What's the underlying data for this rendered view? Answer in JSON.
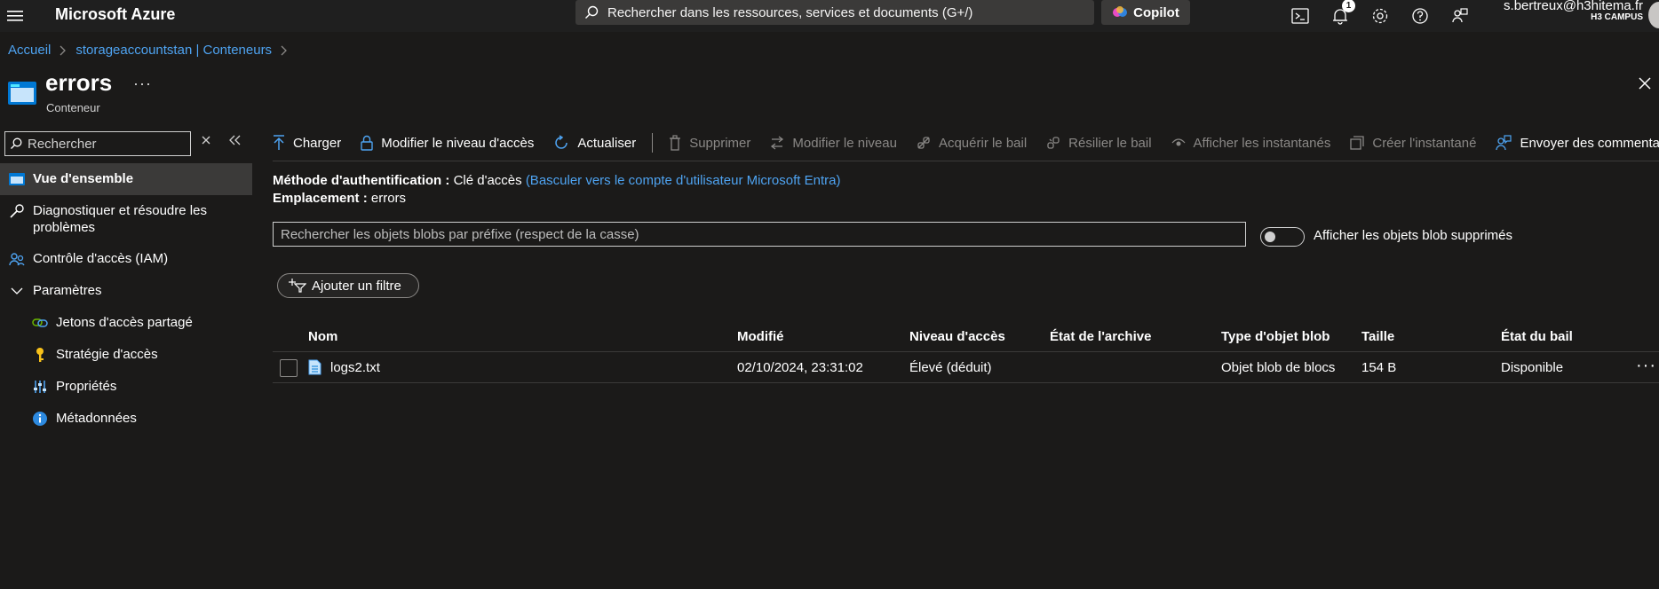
{
  "topbar": {
    "brand": "Microsoft Azure",
    "search_placeholder": "Rechercher dans les ressources, services et documents (G+/)",
    "copilot_label": "Copilot",
    "notification_count": "1",
    "user_email": "s.bertreux@h3hitema.fr",
    "user_tenant": "H3 CAMPUS"
  },
  "breadcrumb": {
    "items": [
      "Accueil",
      "storageaccountstan | Conteneurs"
    ]
  },
  "header": {
    "title": "errors",
    "subtitle": "Conteneur",
    "more": "···"
  },
  "sidebar": {
    "search_placeholder": "Rechercher",
    "items": [
      {
        "label": "Vue d'ensemble",
        "icon": "container-icon",
        "active": true
      },
      {
        "label": "Diagnostiquer et résoudre les problèmes",
        "icon": "wrench-icon"
      },
      {
        "label": "Contrôle d'accès (IAM)",
        "icon": "people-icon"
      },
      {
        "label": "Paramètres",
        "icon": "chevron-down-icon",
        "section": true
      },
      {
        "label": "Jetons d'accès partagé",
        "icon": "link-icon",
        "sub": true
      },
      {
        "label": "Stratégie d'accès",
        "icon": "key-icon",
        "sub": true
      },
      {
        "label": "Propriétés",
        "icon": "properties-icon",
        "sub": true
      },
      {
        "label": "Métadonnées",
        "icon": "info-icon",
        "sub": true
      }
    ]
  },
  "toolbar": {
    "charger": "Charger",
    "modifier_acces": "Modifier le niveau d'accès",
    "actualiser": "Actualiser",
    "supprimer": "Supprimer",
    "modifier_niveau": "Modifier le niveau",
    "acquerir_bail": "Acquérir le bail",
    "resilier_bail": "Résilier le bail",
    "afficher_instantanes": "Afficher les instantanés",
    "creer_instantane": "Créer l'instantané",
    "envoyer_commentaires": "Envoyer des commentaires"
  },
  "details": {
    "auth_label": "Méthode d'authentification :",
    "auth_value": "Clé d'accès",
    "auth_link": "(Basculer vers le compte d'utilisateur Microsoft Entra)",
    "location_label": "Emplacement :",
    "location_value": "errors",
    "prefix_placeholder": "Rechercher les objets blobs par préfixe (respect de la casse)",
    "show_deleted_label": "Afficher les objets blob supprimés",
    "show_deleted_on": false,
    "add_filter_label": "Ajouter un filtre"
  },
  "table": {
    "columns": [
      "Nom",
      "Modifié",
      "Niveau d'accès",
      "État de l'archive",
      "Type d'objet blob",
      "Taille",
      "État du bail"
    ],
    "rows": [
      {
        "name": "logs2.txt",
        "modified": "02/10/2024, 23:31:02",
        "tier": "Élevé (déduit)",
        "archive": "",
        "type": "Objet blob de blocs",
        "size": "154 B",
        "lease": "Disponible"
      }
    ]
  },
  "colors": {
    "background": "#1b1a19",
    "link": "#4ea3f1",
    "active_nav": "#3b3a39"
  }
}
